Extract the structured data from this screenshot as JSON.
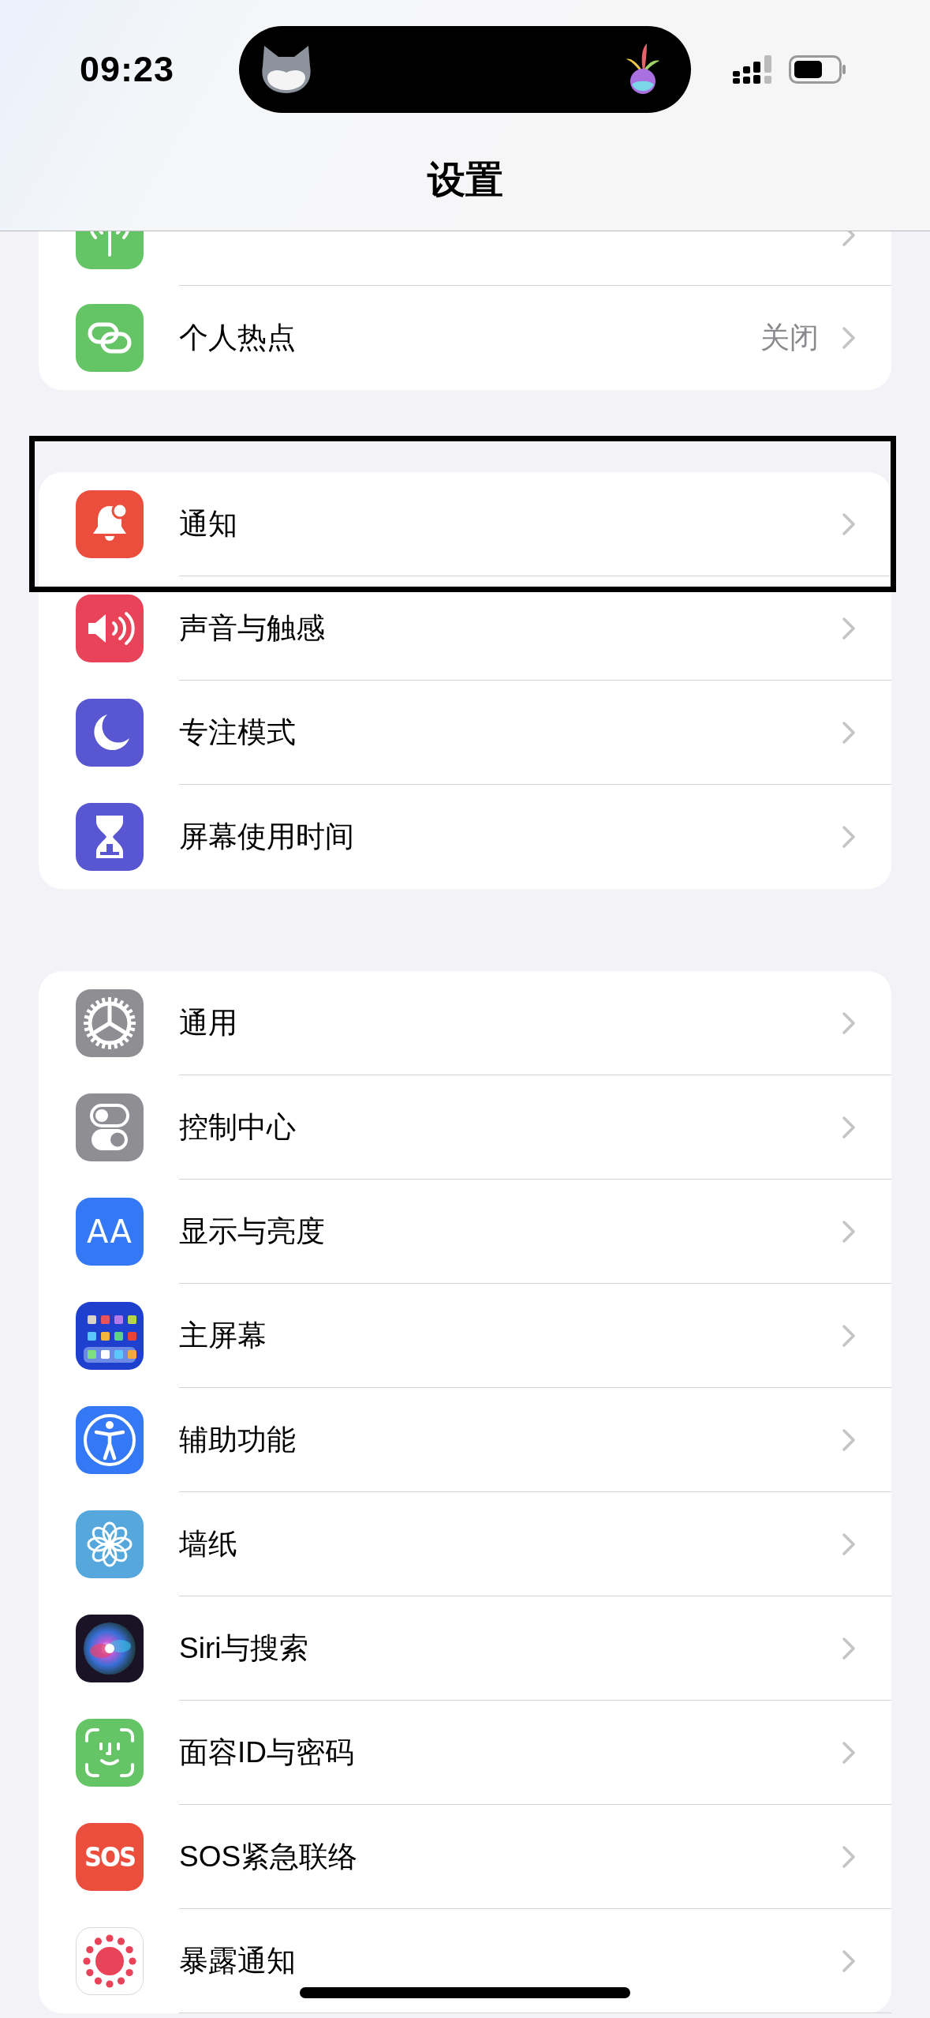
{
  "status_bar": {
    "time": "09:23"
  },
  "title": "设置",
  "groups": [
    {
      "rows": [
        {
          "kind": "cellular",
          "highlighted": false
        },
        {
          "kind": "hotspot",
          "label": "个人热点",
          "value": "关闭",
          "highlighted": false
        }
      ]
    },
    {
      "rows": [
        {
          "kind": "bell",
          "label": "通知",
          "highlighted": true
        },
        {
          "kind": "speaker",
          "label": "声音与触感",
          "highlighted": false
        },
        {
          "kind": "moon",
          "label": "专注模式",
          "highlighted": false
        },
        {
          "kind": "hourglass",
          "label": "屏幕使用时间",
          "highlighted": false
        }
      ]
    },
    {
      "rows": [
        {
          "kind": "gear",
          "label": "通用",
          "highlighted": false
        },
        {
          "kind": "toggles",
          "label": "控制中心",
          "highlighted": false
        },
        {
          "kind": "letters",
          "icon_text": "AA",
          "label": "显示与亮度",
          "highlighted": false
        },
        {
          "kind": "grid",
          "label": "主屏幕",
          "highlighted": false
        },
        {
          "kind": "accessibility",
          "label": "辅助功能",
          "highlighted": false
        },
        {
          "kind": "flower",
          "label": "墙纸",
          "highlighted": false
        },
        {
          "kind": "orb",
          "label": "Siri与搜索",
          "highlighted": false
        },
        {
          "kind": "face",
          "label": "面容ID与密码",
          "highlighted": false
        },
        {
          "kind": "letters-red",
          "icon_text": "SOS",
          "label": "SOS紧急联络",
          "highlighted": false
        },
        {
          "kind": "sun",
          "label": "暴露通知",
          "highlighted": false
        }
      ]
    }
  ]
}
